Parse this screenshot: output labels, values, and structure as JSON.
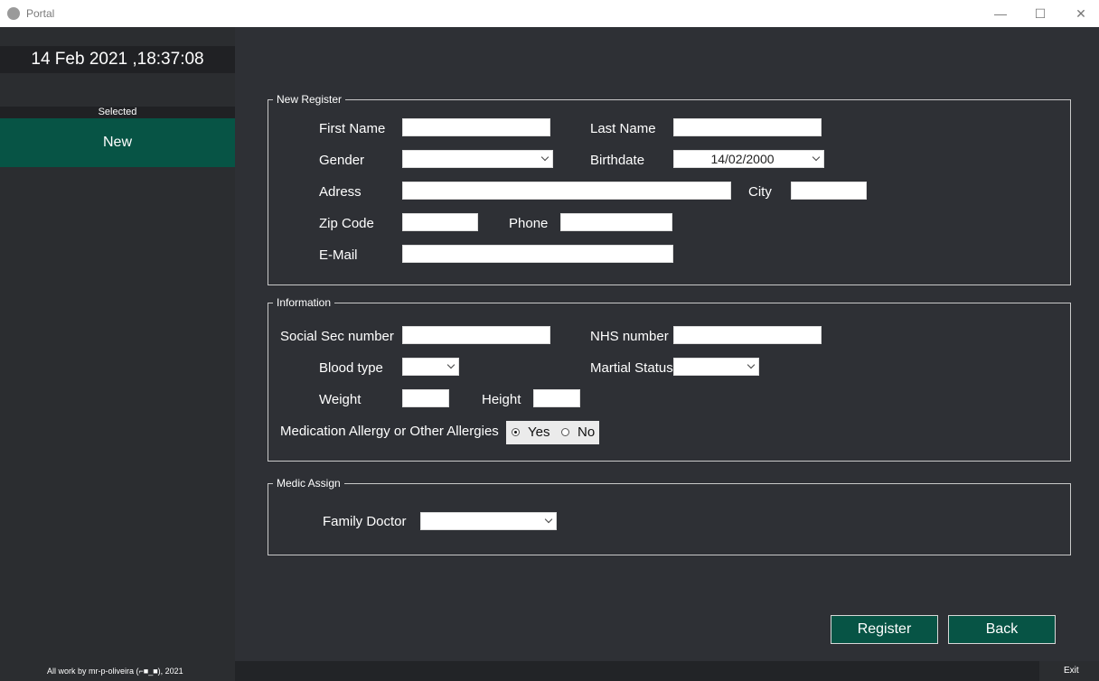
{
  "window": {
    "title": "Portal",
    "minimize_glyph": "—",
    "maximize_glyph": "☐",
    "close_glyph": "✕"
  },
  "sidebar": {
    "clock": "14 Feb 2021 ,18:37:08",
    "selected_label": "Selected",
    "nav_item": "New"
  },
  "sections": {
    "new_register": {
      "legend": "New Register",
      "first_name_label": "First Name",
      "first_name_value": "",
      "last_name_label": "Last Name",
      "last_name_value": "",
      "gender_label": "Gender",
      "gender_value": "",
      "birthdate_label": "Birthdate",
      "birthdate_value": "14/02/2000",
      "address_label": "Adress",
      "address_value": "",
      "city_label": "City",
      "city_value": "",
      "zip_label": "Zip Code",
      "zip_value": "",
      "phone_label": "Phone",
      "phone_value": "",
      "email_label": "E-Mail",
      "email_value": ""
    },
    "information": {
      "legend": "Information",
      "social_sec_label": "Social Sec number",
      "social_sec_value": "",
      "nhs_label": "NHS number",
      "nhs_value": "",
      "blood_type_label": "Blood type",
      "blood_type_value": "",
      "marital_label": "Martial Status",
      "marital_value": "",
      "weight_label": "Weight",
      "weight_value": "",
      "height_label": "Height",
      "height_value": "",
      "allergy_label": "Medication Allergy or Other Allergies",
      "allergy_yes": "Yes",
      "allergy_no": "No",
      "allergy_selected": "Yes"
    },
    "medic_assign": {
      "legend": "Medic Assign",
      "family_doctor_label": "Family Doctor",
      "family_doctor_value": ""
    }
  },
  "buttons": {
    "register": "Register",
    "back": "Back"
  },
  "footer": {
    "credit": "All work by mr-p-oliveira (⌐■_■), 2021",
    "exit": "Exit"
  },
  "colors": {
    "accent": "#075445",
    "background": "#2e3035",
    "sidebar": "#2b2d30"
  }
}
